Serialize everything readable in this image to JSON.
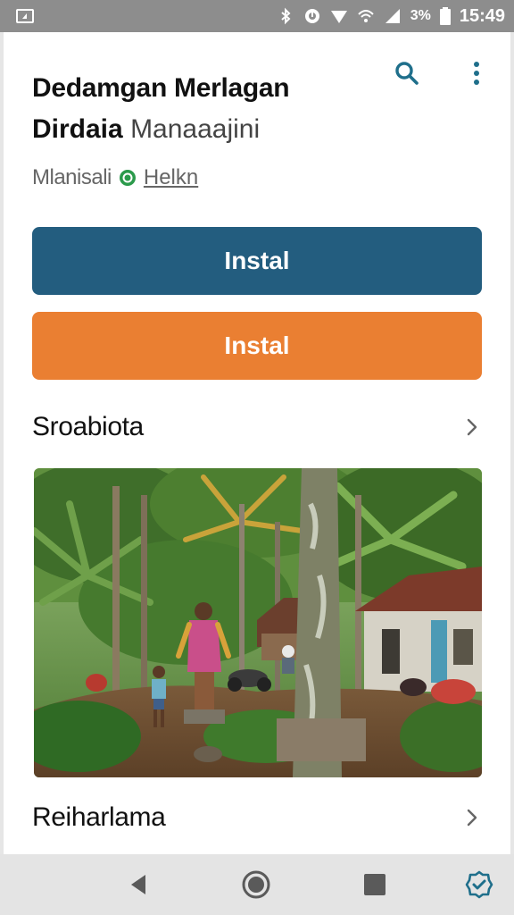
{
  "status_bar": {
    "time": "15:49",
    "battery_text": "3%",
    "icons": [
      "notification-icon",
      "bluetooth-icon",
      "alarm-icon",
      "signal-icon",
      "wifi-icon",
      "cell-signal-icon",
      "battery-icon"
    ]
  },
  "header": {
    "title": "Dedamgan Merlagan",
    "subtitle_bold": "Dirdaia",
    "subtitle_light": "Manaaajini",
    "developer": "Mlanisali",
    "link": "Helkn",
    "icons": {
      "search": "search-icon",
      "more": "more-vertical-icon",
      "verified": "verified-icon"
    }
  },
  "buttons": {
    "primary_label": "Instal",
    "secondary_label": "Instal"
  },
  "sections": [
    {
      "title": "Sroabiota"
    },
    {
      "title": "Reiharlama"
    }
  ],
  "colors": {
    "primary_button": "#235d7f",
    "secondary_button": "#ea7f32",
    "accent_icon": "#1f6f8b",
    "status_bar": "#8d8d8d",
    "nav_bar": "#e4e4e4"
  },
  "nav_bar": {
    "icons": [
      "back-icon",
      "home-icon",
      "recents-icon",
      "check-badge-icon"
    ]
  }
}
